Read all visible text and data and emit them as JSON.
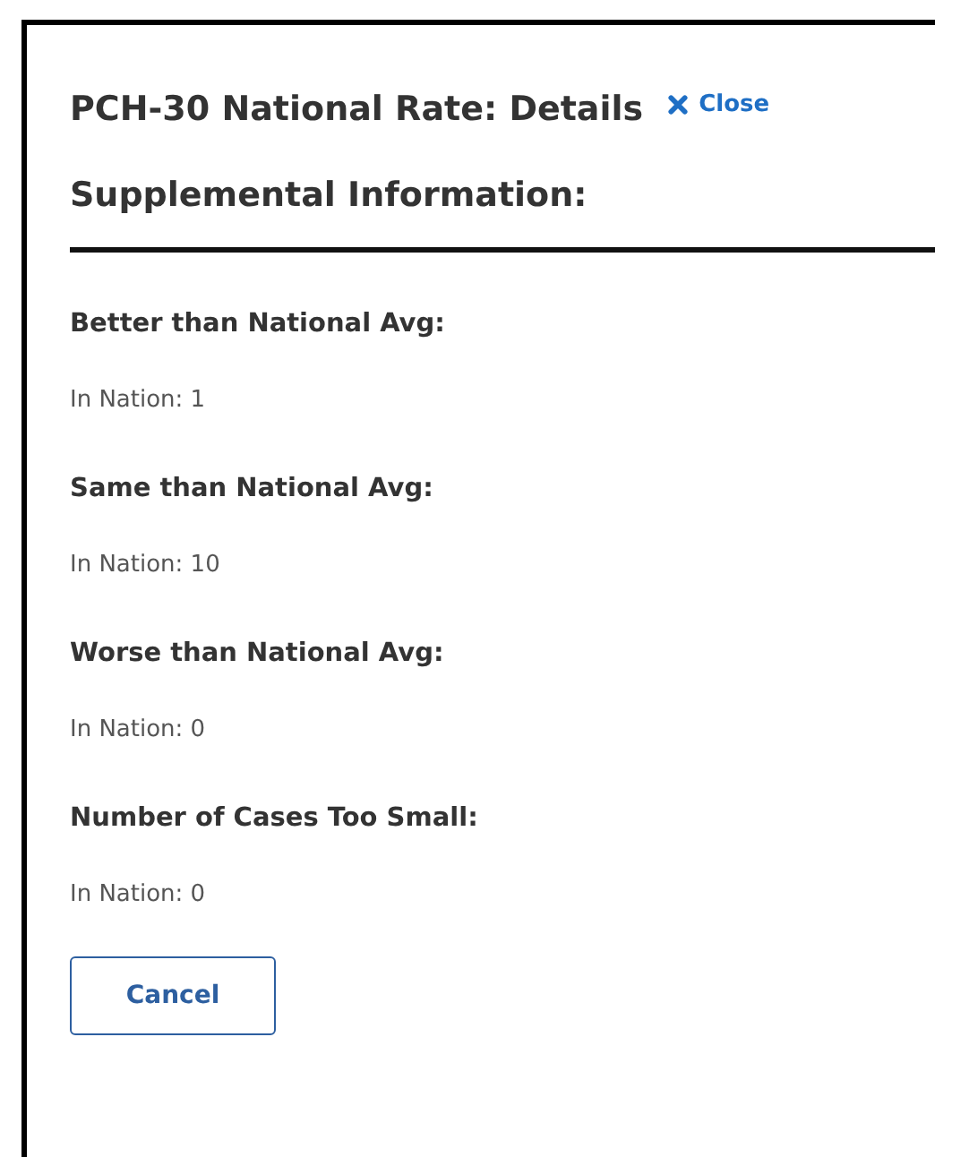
{
  "dialog": {
    "title": "PCH-30 National Rate: Details",
    "close_label": "Close",
    "subtitle": "Supplemental Information:",
    "sections": [
      {
        "heading": "Better than National Avg:",
        "value": "In Nation: 1"
      },
      {
        "heading": "Same than National Avg:",
        "value": "In Nation: 10"
      },
      {
        "heading": "Worse than National Avg:",
        "value": "In Nation: 0"
      },
      {
        "heading": "Number of Cases Too Small:",
        "value": "In Nation: 0"
      }
    ],
    "buttons": [
      "Cancel"
    ]
  }
}
